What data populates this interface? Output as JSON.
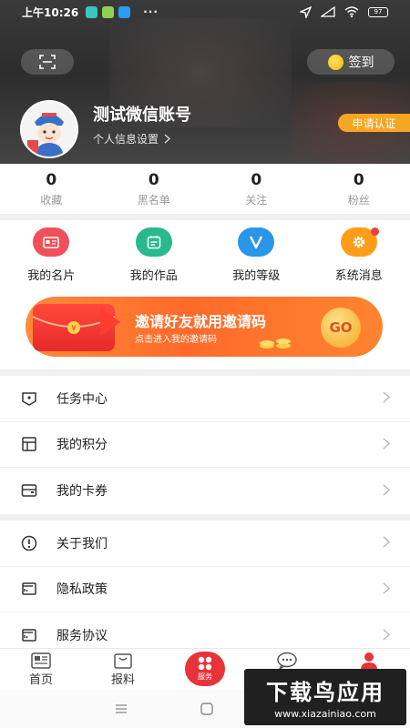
{
  "status_bar": {
    "time": "上午10:26",
    "dots": "···",
    "battery": "97"
  },
  "header": {
    "checkin_label": "签到",
    "username": "测试微信账号",
    "settings_label": "个人信息设置",
    "apply_label": "申请认证"
  },
  "stats": [
    {
      "value": "0",
      "label": "收藏"
    },
    {
      "value": "0",
      "label": "黑名单"
    },
    {
      "value": "0",
      "label": "关注"
    },
    {
      "value": "0",
      "label": "粉丝"
    }
  ],
  "functions": [
    {
      "label": "我的名片",
      "color": "#f0505a",
      "icon": "card-icon"
    },
    {
      "label": "我的作品",
      "color": "#28b98c",
      "icon": "works-icon"
    },
    {
      "label": "我的等级",
      "color": "#2a96e8",
      "icon": "level-icon"
    },
    {
      "label": "系统消息",
      "color": "#ff9d1a",
      "icon": "gear-icon"
    }
  ],
  "banner": {
    "title": "邀请好友就用邀请码",
    "subtitle": "点击进入我的邀请码",
    "go_label": "GO"
  },
  "menu_group1": [
    {
      "label": "任务中心",
      "icon": "task-icon"
    },
    {
      "label": "我的积分",
      "icon": "points-icon"
    },
    {
      "label": "我的卡券",
      "icon": "coupon-icon"
    }
  ],
  "menu_group2": [
    {
      "label": "关于我们",
      "icon": "info-icon"
    },
    {
      "label": "隐私政策",
      "icon": "privacy-icon"
    },
    {
      "label": "服务协议",
      "icon": "agreement-icon"
    }
  ],
  "bottom_nav": {
    "home": "首页",
    "news": "报料",
    "service": "服务",
    "interact": "互动",
    "mine": "我的"
  },
  "watermark": {
    "title": "下载鸟应用",
    "url": "www.xiazainiao.com"
  },
  "colors": {
    "accent": "#e8333a",
    "apply_button": "#f6a623"
  }
}
